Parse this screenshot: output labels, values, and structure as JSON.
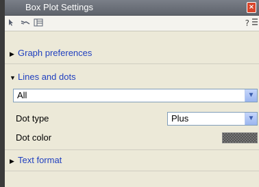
{
  "window": {
    "title": "Box Plot Settings",
    "close_label": "×"
  },
  "toolbar": {
    "icons": [
      "pointer-icon",
      "link-icon",
      "layout-icon"
    ],
    "help_label": "?",
    "list_icon": "list-icon"
  },
  "sections": {
    "graph_preferences": {
      "label": "Graph preferences",
      "expanded": false
    },
    "lines_and_dots": {
      "label": "Lines and dots",
      "expanded": true,
      "series_select": {
        "value": "All"
      },
      "dot_type": {
        "label": "Dot type",
        "value": "Plus"
      },
      "dot_color": {
        "label": "Dot color",
        "color": "#555555"
      }
    },
    "text_format": {
      "label": "Text format",
      "expanded": false
    }
  },
  "colors": {
    "section_link": "#1f3fbf",
    "titlebar": "#6b7079",
    "panel_bg": "#ece9d8"
  }
}
